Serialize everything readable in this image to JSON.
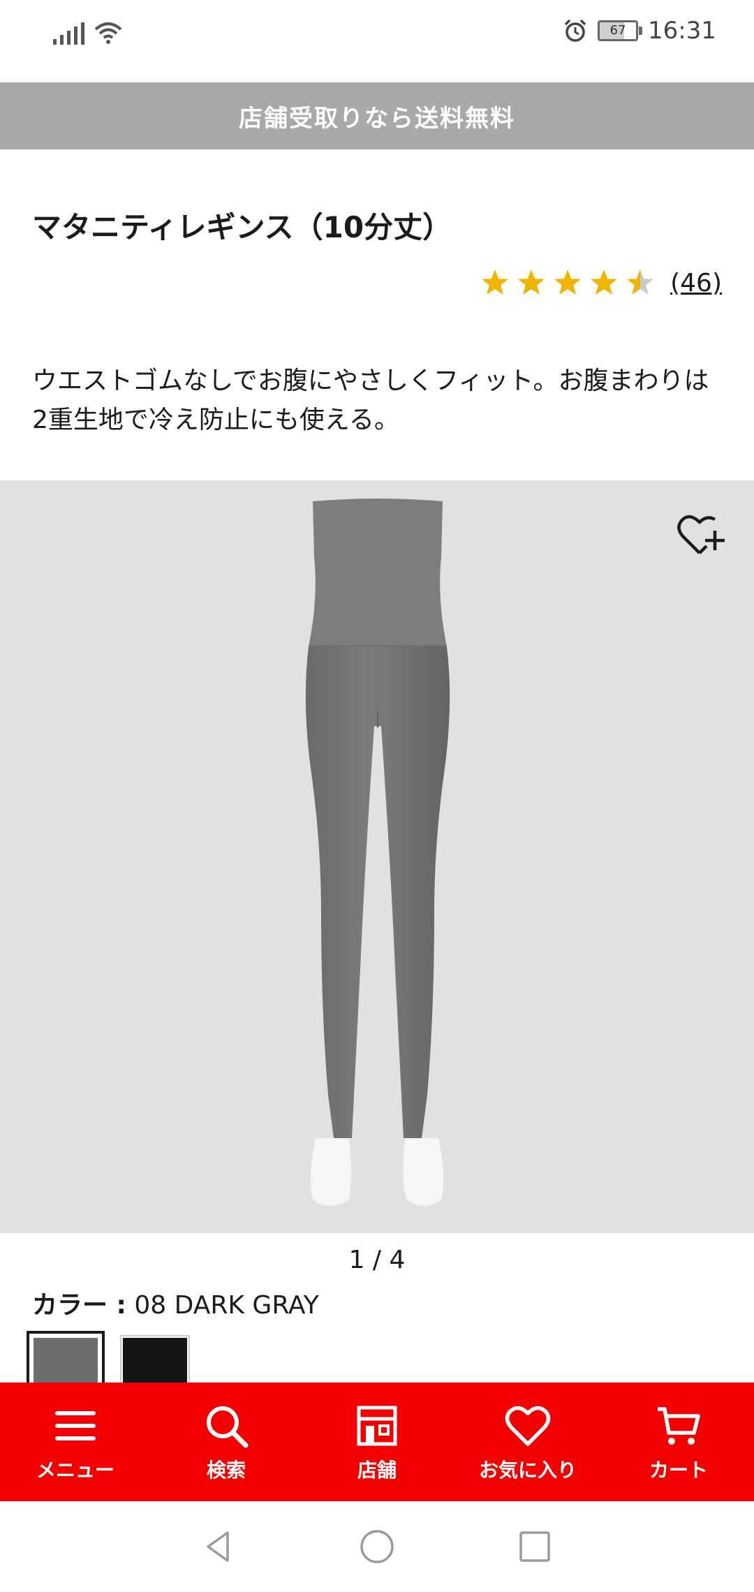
{
  "status_bar": {
    "time": "16:31",
    "battery_level": "67",
    "icons": [
      "signal-icon",
      "wifi-icon",
      "alarm-icon",
      "battery-icon"
    ]
  },
  "promo_banner": {
    "text": "店舗受取りなら送料無料"
  },
  "product": {
    "title": "マタニティレギンス（10分丈）",
    "rating": 4.5,
    "rating_max": 5,
    "review_count": "(46)",
    "description": "ウエストゴムなしでお腹にやさしくフィット。お腹まわりは2重生地で冷え防止にも使える。"
  },
  "gallery": {
    "counter": "1 / 4",
    "favorite_icon": "heart-plus-icon"
  },
  "color": {
    "label": "カラー :",
    "value": "08 DARK GRAY",
    "swatches": [
      {
        "color": "#6c6c6c",
        "selected": true
      },
      {
        "color": "#161616",
        "selected": false
      }
    ]
  },
  "bottom_nav": {
    "items": [
      {
        "label": "メニュー",
        "icon": "menu-icon"
      },
      {
        "label": "検索",
        "icon": "search-icon"
      },
      {
        "label": "店舗",
        "icon": "store-icon"
      },
      {
        "label": "お気に入り",
        "icon": "heart-icon"
      },
      {
        "label": "カート",
        "icon": "cart-icon"
      }
    ]
  },
  "colors": {
    "brand_red": "#f40000",
    "promo_gray": "#a9a9a9",
    "star_gold": "#f0b400"
  }
}
